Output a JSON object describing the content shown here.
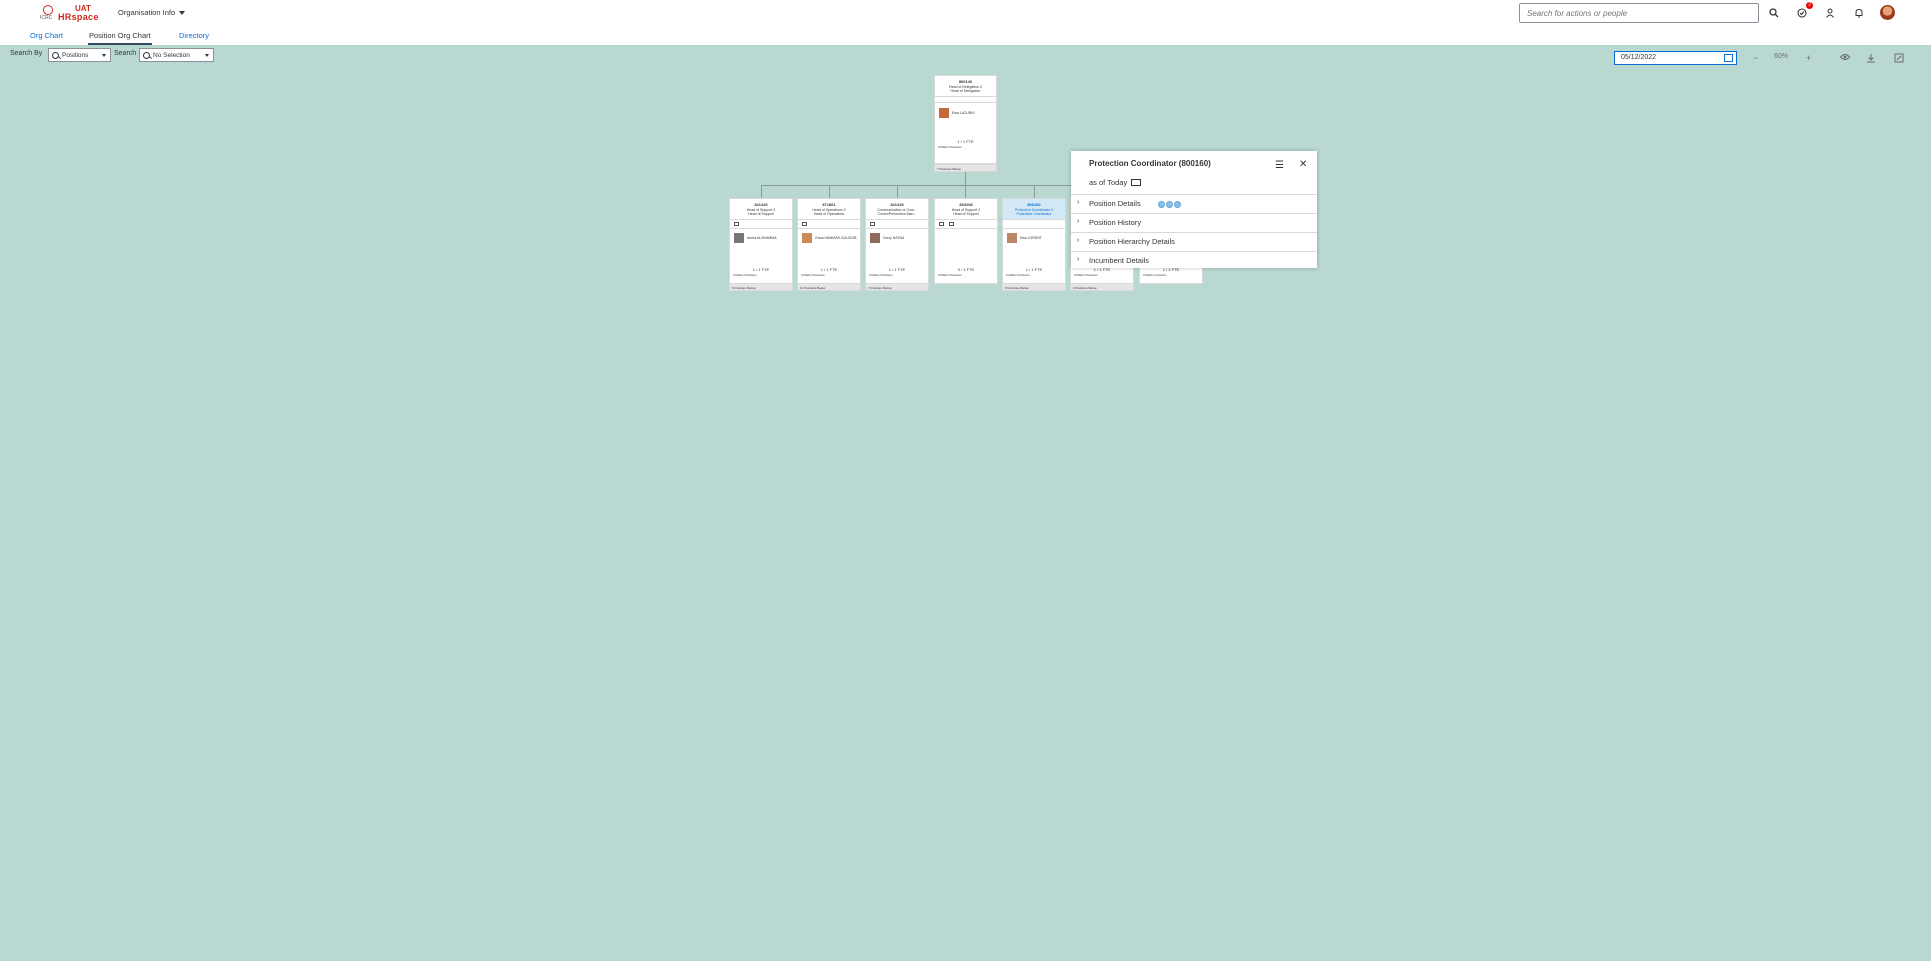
{
  "shell": {
    "logo_org": "ICRC",
    "logo_uat": "UAT",
    "logo_product": "HRspace",
    "app_title": "Organisation Info",
    "search_placeholder": "Search for actions or people",
    "notification_badge": "2"
  },
  "tabs": [
    "Org Chart",
    "Position Org Chart",
    "Directory"
  ],
  "toolbar": {
    "search_by_label": "Search By",
    "search_by_value": "Positions",
    "search_label": "Search",
    "search_value": "No Selection",
    "date": "05/12/2022",
    "zoom": "60%"
  },
  "chart": {
    "root": {
      "code": "800140",
      "line1": "Head of Delegation 2",
      "line2": "Head of Delegation",
      "person": "Ewa LAZURKI",
      "fte": "1 / 1 FTE",
      "vacancy": "0 Matrix Positions",
      "below": "7 Positions Below"
    },
    "children": [
      {
        "code": "841443",
        "line1": "Head of Support 3",
        "line2": "Head of Support",
        "person": "Amira ALSHAMMA",
        "fte": "1 / 1 FTE",
        "vacancy": "0 Matrix Positions",
        "below": "6 Positions Below"
      },
      {
        "code": "871861",
        "line1": "Head of Operations 2",
        "line2": "Head of Operations",
        "person": "Guna HAMMAR-SULISOB",
        "fte": "1 / 1 FTE",
        "vacancy": "0 Matrix Positions",
        "below": "10 Positions Below"
      },
      {
        "code": "841418",
        "line1": "Communication or Com...",
        "line2": "Comm/Prevention Man...",
        "person": "Gerry HATNA",
        "fte": "1 / 1 FTE",
        "vacancy": "0 Matrix Positions",
        "below": "7 Positions Below"
      },
      {
        "code": "833208",
        "line1": "Head of Support 2",
        "line2": "Head of Support",
        "person": "",
        "fte": "0 / 1 FTE",
        "vacancy": "0 Matrix Positions",
        "below": ""
      },
      {
        "code": "800160",
        "line1": "Protection Coordinator 2",
        "line2": "Protection Coordinator",
        "person": "Kiss LORENT",
        "fte": "1 / 1 FTE",
        "vacancy": "0 Matrix Positions",
        "below": "8 Positions Below"
      },
      {
        "code": "",
        "line1": "",
        "line2": "",
        "person": "",
        "fte": "1 / 1 FTE",
        "vacancy": "0 Matrix Positions",
        "below": "3 Positions Below"
      },
      {
        "code": "",
        "line1": "",
        "line2": "",
        "person": "",
        "fte": "1 / 1 FTE",
        "vacancy": "0 Matrix Positions",
        "below": ""
      }
    ]
  },
  "popover": {
    "title": "Protection Coordinator (800160)",
    "as_of": "as of Today",
    "sections": [
      "Position Details",
      "Position History",
      "Position Hierarchy Details",
      "Incumbent Details"
    ]
  }
}
